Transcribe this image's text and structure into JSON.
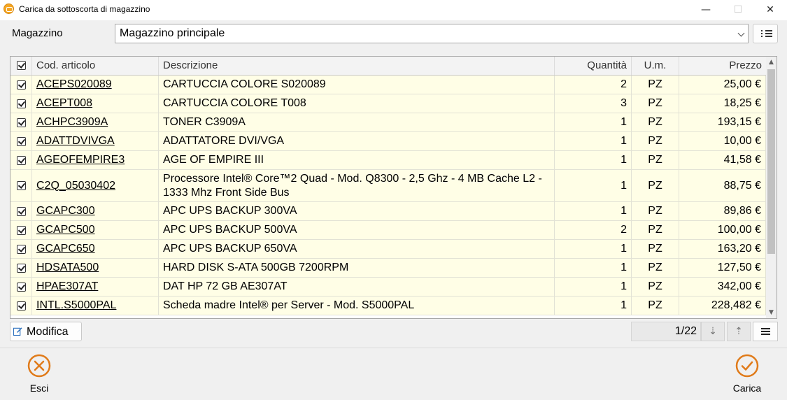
{
  "window": {
    "title": "Carica da sottoscorta di magazzino",
    "minimize_glyph": "—",
    "maximize_glyph": "☐",
    "close_glyph": "✕"
  },
  "warehouse": {
    "label": "Magazzino",
    "selected": "Magazzino principale"
  },
  "table": {
    "headers": {
      "code": "Cod. articolo",
      "description": "Descrizione",
      "quantity": "Quantità",
      "unit": "U.m.",
      "price": "Prezzo"
    },
    "rows": [
      {
        "checked": true,
        "code": "ACEPS020089",
        "description": "CARTUCCIA COLORE S020089",
        "quantity": "2",
        "unit": "PZ",
        "price": "25,00 €"
      },
      {
        "checked": true,
        "code": "ACEPT008",
        "description": "CARTUCCIA COLORE T008",
        "quantity": "3",
        "unit": "PZ",
        "price": "18,25 €"
      },
      {
        "checked": true,
        "code": "ACHPC3909A",
        "description": "TONER C3909A",
        "quantity": "1",
        "unit": "PZ",
        "price": "193,15 €"
      },
      {
        "checked": true,
        "code": "ADATTDVIVGA",
        "description": "ADATTATORE DVI/VGA",
        "quantity": "1",
        "unit": "PZ",
        "price": "10,00 €"
      },
      {
        "checked": true,
        "code": "AGEOFEMPIRE3",
        "description": "AGE OF EMPIRE III",
        "quantity": "1",
        "unit": "PZ",
        "price": "41,58 €"
      },
      {
        "checked": true,
        "code": "C2Q_05030402",
        "description": "Processore Intel® Core™2 Quad - Mod. Q8300 - 2,5 Ghz - 4 MB Cache L2 - 1333 Mhz Front Side Bus",
        "quantity": "1",
        "unit": "PZ",
        "price": "88,75 €"
      },
      {
        "checked": true,
        "code": "GCAPC300",
        "description": "APC UPS BACKUP 300VA",
        "quantity": "1",
        "unit": "PZ",
        "price": "89,86 €"
      },
      {
        "checked": true,
        "code": "GCAPC500",
        "description": "APC UPS BACKUP 500VA",
        "quantity": "2",
        "unit": "PZ",
        "price": "100,00 €"
      },
      {
        "checked": true,
        "code": "GCAPC650",
        "description": "APC UPS BACKUP 650VA",
        "quantity": "1",
        "unit": "PZ",
        "price": "163,20 €"
      },
      {
        "checked": true,
        "code": "HDSATA500",
        "description": "HARD DISK S-ATA 500GB 7200RPM",
        "quantity": "1",
        "unit": "PZ",
        "price": "127,50 €"
      },
      {
        "checked": true,
        "code": "HPAE307AT",
        "description": "DAT HP 72 GB AE307AT",
        "quantity": "1",
        "unit": "PZ",
        "price": "342,00 €"
      },
      {
        "checked": true,
        "code": "INTL.S5000PAL",
        "description": "Scheda madre Intel® per Server - Mod. S5000PAL",
        "quantity": "1",
        "unit": "PZ",
        "price": "228,482 €"
      }
    ]
  },
  "toolbar": {
    "edit_label": "Modifica",
    "page_indicator": "1/22"
  },
  "footer": {
    "exit_label": "Esci",
    "load_label": "Carica"
  },
  "colors": {
    "accent": "#e07b1a",
    "row_background": "#fffee6"
  }
}
